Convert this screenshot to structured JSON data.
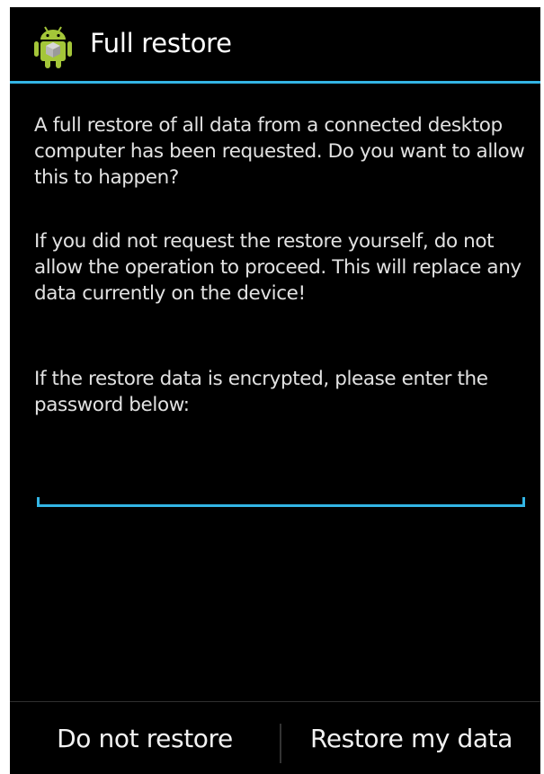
{
  "dialog": {
    "title": "Full restore",
    "icon": "android-robot-icon",
    "accent_color": "#33b5e5",
    "background_color": "#000000",
    "paragraphs": [
      "A full restore of all data from a connected desktop computer has been requested. Do you want to allow this to happen?",
      "If you did not request the restore yourself, do not allow the operation to proceed. This will replace any data currently on the device!",
      "If the restore data is encrypted, please enter the password below:"
    ],
    "password_field": {
      "value": "",
      "placeholder": ""
    },
    "buttons": {
      "deny_label": "Do not restore",
      "allow_label": "Restore my data"
    }
  }
}
